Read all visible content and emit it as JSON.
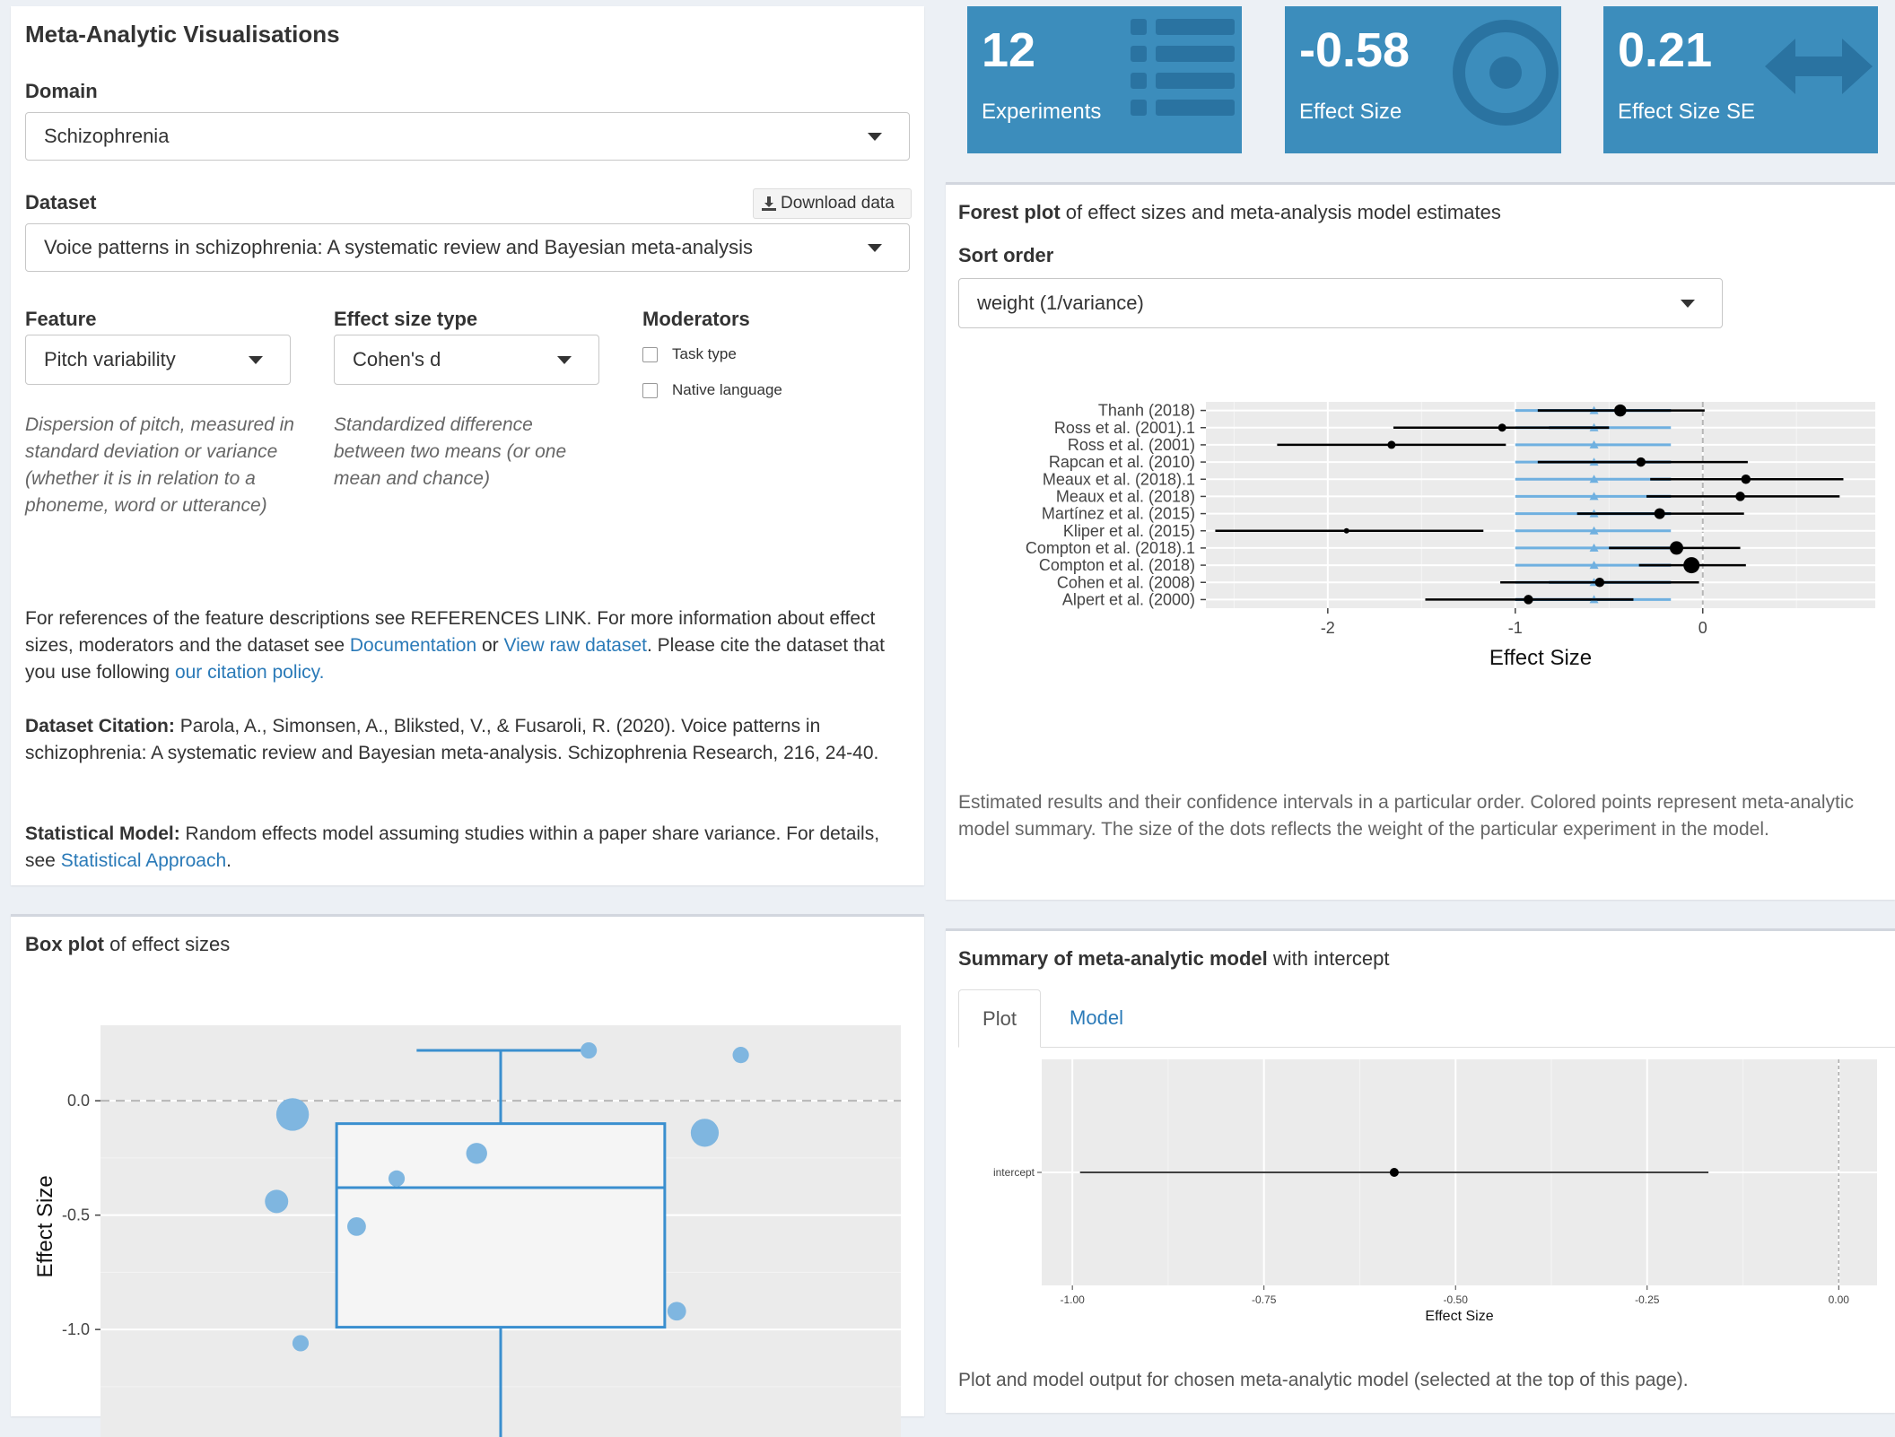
{
  "left_panel": {
    "title": "Meta-Analytic Visualisations",
    "domain_label": "Domain",
    "domain_value": "Schizophrenia",
    "dataset_label": "Dataset",
    "download_label": "Download data",
    "dataset_value": "Voice patterns in schizophrenia: A systematic review and Bayesian meta-analysis",
    "feature_label": "Feature",
    "feature_value": "Pitch variability",
    "feature_desc": "Dispersion of pitch, measured in standard deviation or variance (whether it is in relation to a phoneme, word or utterance)",
    "effect_type_label": "Effect size type",
    "effect_type_value": "Cohen's d",
    "effect_type_desc": "Standardized difference between two means (or one mean and chance)",
    "moderators_label": "Moderators",
    "moderators": [
      "Task type",
      "Native language"
    ],
    "refs_text_1": "For references of the feature descriptions see REFERENCES LINK. For more information about effect sizes, moderators and the dataset see ",
    "refs_link_doc": "Documentation",
    "refs_text_or": " or ",
    "refs_link_raw": "View raw dataset",
    "refs_text_2": ". Please cite the dataset that you use following ",
    "refs_link_policy": "our citation policy.",
    "citation_label": "Dataset Citation:",
    "citation_text": " Parola, A., Simonsen, A., Bliksted, V., & Fusaroli, R. (2020). Voice patterns in schizophrenia: A systematic review and Bayesian meta-analysis. Schizophrenia Research, 216, 24-40.",
    "model_label": "Statistical Model:",
    "model_text": " Random effects model assuming studies within a paper share variance. For details, see ",
    "model_link": "Statistical Approach",
    "model_end": "."
  },
  "value_boxes": [
    {
      "value": "12",
      "caption": "Experiments",
      "icon": "list-icon"
    },
    {
      "value": "-0.58",
      "caption": "Effect Size",
      "icon": "bullseye-icon"
    },
    {
      "value": "0.21",
      "caption": "Effect Size SE",
      "icon": "arrows-h-icon"
    }
  ],
  "forest_panel": {
    "title_bold": "Forest plot",
    "title_rest": " of effect sizes and meta-analysis model estimates",
    "sort_label": "Sort order",
    "sort_value": "weight (1/variance)",
    "caption": "Estimated results and their confidence intervals in a particular order. Colored points represent meta-analytic model summary. The size of the dots reflects the weight of the particular experiment in the model."
  },
  "box_panel": {
    "title_bold": "Box plot",
    "title_rest": " of effect sizes"
  },
  "summary_panel": {
    "title_bold": "Summary of meta-analytic model",
    "title_rest": " with intercept",
    "tabs": [
      "Plot",
      "Model"
    ],
    "active_tab": "Plot",
    "caption": "Plot and model output for chosen meta-analytic model (selected at the top of this page)."
  },
  "colors": {
    "accent": "#3c8dbc",
    "link": "#2a7ab8",
    "plot_bg": "#ebebeb",
    "model_dark": "#1f5a8a",
    "model_light": "#6fb0e0",
    "point": "#000000",
    "box_blue": "#3a8fcf",
    "box_point": "#7fb6e0"
  },
  "chart_data": [
    {
      "type": "scatter",
      "name": "forest",
      "xlabel": "Effect Size",
      "ylabel": "",
      "xlim": [
        -2.65,
        0.92
      ],
      "xticks": [
        -2,
        -1,
        0
      ],
      "reference_line": 0,
      "studies": [
        {
          "label": "Thanh (2018)",
          "es": -0.44,
          "lo": -0.88,
          "hi": 0.01,
          "w": 9,
          "m_es": -0.58,
          "m_dlo": -0.88,
          "m_dhi": -0.17,
          "m_llo": -1.0,
          "m_lhi": -0.17
        },
        {
          "label": "Ross et al. (2001).1",
          "es": -1.07,
          "lo": -1.65,
          "hi": -0.5,
          "w": 6,
          "m_es": -0.58,
          "m_dlo": -0.82,
          "m_dhi": -0.5,
          "m_llo": -1.0,
          "m_lhi": -0.17
        },
        {
          "label": "Ross et al. (2001)",
          "es": -1.66,
          "lo": -2.27,
          "hi": -1.05,
          "w": 6,
          "m_es": -0.58,
          "m_dlo": -0.58,
          "m_dhi": -0.58,
          "m_llo": -1.0,
          "m_lhi": -0.17
        },
        {
          "label": "Rapcan et al. (2010)",
          "es": -0.33,
          "lo": -0.88,
          "hi": 0.24,
          "w": 7,
          "m_es": -0.58,
          "m_dlo": -0.88,
          "m_dhi": -0.17,
          "m_llo": -1.0,
          "m_lhi": -0.17
        },
        {
          "label": "Meaux et al. (2018).1",
          "es": 0.23,
          "lo": -0.28,
          "hi": 0.75,
          "w": 7,
          "m_es": -0.58,
          "m_dlo": -0.28,
          "m_dhi": -0.17,
          "m_llo": -1.0,
          "m_lhi": -0.17
        },
        {
          "label": "Meaux et al. (2018)",
          "es": 0.2,
          "lo": -0.3,
          "hi": 0.73,
          "w": 7,
          "m_es": -0.58,
          "m_dlo": -0.3,
          "m_dhi": -0.17,
          "m_llo": -1.0,
          "m_lhi": -0.17
        },
        {
          "label": "Martínez et al. (2015)",
          "es": -0.23,
          "lo": -0.67,
          "hi": 0.22,
          "w": 8,
          "m_es": -0.58,
          "m_dlo": -0.67,
          "m_dhi": -0.17,
          "m_llo": -1.0,
          "m_lhi": -0.17
        },
        {
          "label": "Kliper et al. (2015)",
          "es": -1.9,
          "lo": -2.6,
          "hi": -1.17,
          "w": 4,
          "m_es": -0.58,
          "m_dlo": -0.58,
          "m_dhi": -0.58,
          "m_llo": -1.0,
          "m_lhi": -0.17
        },
        {
          "label": "Compton et al. (2018).1",
          "es": -0.14,
          "lo": -0.5,
          "hi": 0.2,
          "w": 10,
          "m_es": -0.58,
          "m_dlo": -0.5,
          "m_dhi": -0.17,
          "m_llo": -1.0,
          "m_lhi": -0.17
        },
        {
          "label": "Compton et al. (2018)",
          "es": -0.06,
          "lo": -0.34,
          "hi": 0.23,
          "w": 12,
          "m_es": -0.58,
          "m_dlo": -0.34,
          "m_dhi": -0.17,
          "m_llo": -1.0,
          "m_lhi": -0.17
        },
        {
          "label": "Cohen et al. (2008)",
          "es": -0.55,
          "lo": -1.08,
          "hi": -0.02,
          "w": 7,
          "m_es": -0.58,
          "m_dlo": -0.82,
          "m_dhi": -0.17,
          "m_llo": -1.0,
          "m_lhi": -0.17
        },
        {
          "label": "Alpert et al. (2000)",
          "es": -0.93,
          "lo": -1.48,
          "hi": -0.37,
          "w": 7,
          "m_es": -0.58,
          "m_dlo": -1.0,
          "m_dhi": -0.37,
          "m_llo": -1.0,
          "m_lhi": -0.17
        }
      ]
    },
    {
      "type": "scatter",
      "name": "boxplot",
      "ylabel": "Effect Size",
      "ylim": [
        -1.47,
        0.33
      ],
      "yticks": [
        0.0,
        -0.5,
        -1.0
      ],
      "ytick_labels": [
        "0.0",
        "-0.5",
        "-1.0"
      ],
      "reference_line": 0,
      "box": {
        "q1": -0.99,
        "median": -0.38,
        "q3": -0.1,
        "whisker_high": 0.22
      },
      "points": [
        {
          "x": 0.24,
          "y": -0.06,
          "size": 14
        },
        {
          "x": 0.22,
          "y": -0.44,
          "size": 10
        },
        {
          "x": 0.25,
          "y": -1.06,
          "size": 7
        },
        {
          "x": 0.32,
          "y": -0.55,
          "size": 8
        },
        {
          "x": 0.37,
          "y": -0.34,
          "size": 7
        },
        {
          "x": 0.47,
          "y": -0.23,
          "size": 9
        },
        {
          "x": 0.61,
          "y": 0.22,
          "size": 7
        },
        {
          "x": 0.72,
          "y": -0.92,
          "size": 8
        },
        {
          "x": 0.755,
          "y": -0.14,
          "size": 12
        },
        {
          "x": 0.8,
          "y": 0.2,
          "size": 7
        }
      ]
    },
    {
      "type": "scatter",
      "name": "summary",
      "xlabel": "Effect Size",
      "xlim": [
        -1.04,
        0.05
      ],
      "xticks": [
        -1.0,
        -0.75,
        -0.5,
        -0.25,
        0.0
      ],
      "xtick_labels": [
        "-1.00",
        "-0.75",
        "-0.50",
        "-0.25",
        "0.00"
      ],
      "reference_line": 0,
      "rows": [
        {
          "label": "intercept",
          "es": -0.58,
          "lo": -0.99,
          "hi": -0.17
        }
      ]
    }
  ]
}
